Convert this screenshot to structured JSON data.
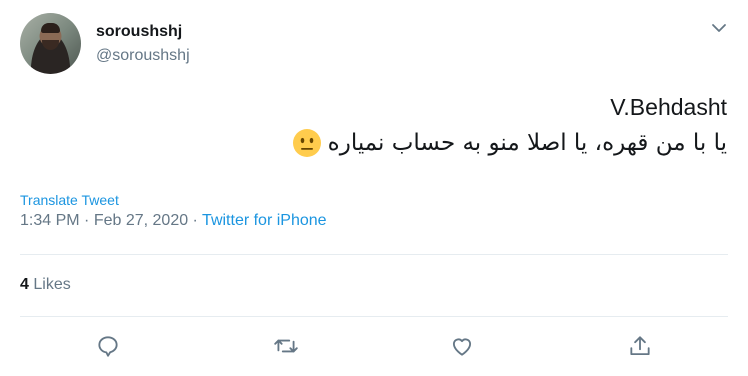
{
  "author": {
    "name": "soroushshj",
    "handle": "@soroushshj"
  },
  "tweet": {
    "line1": "V.Behdasht",
    "line2": "یا با من قهره، یا اصلا منو به حساب نمیاره",
    "emoji": "neutral-face-emoji",
    "translate_label": "Translate Tweet",
    "time": "1:34 PM",
    "separator": " · ",
    "date": "Feb 27, 2020",
    "source": "Twitter for iPhone"
  },
  "stats": {
    "likes_count": "4",
    "likes_label": "Likes"
  },
  "actions": {
    "reply": "reply-icon",
    "retweet": "retweet-icon",
    "like": "heart-icon",
    "share": "share-icon"
  },
  "colors": {
    "link": "#1b95e0",
    "secondary_text": "#657786",
    "icon": "#657786",
    "divider": "#e6ecf0"
  }
}
